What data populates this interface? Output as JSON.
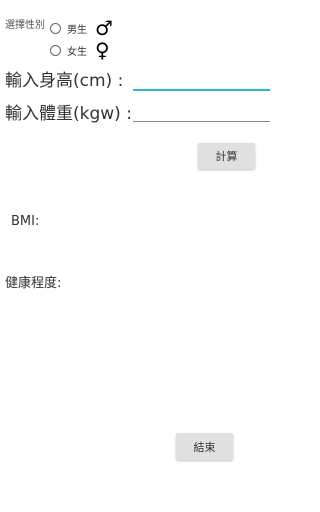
{
  "gender": {
    "label": "選擇性別",
    "options": [
      {
        "label": "男生",
        "icon": "male-symbol-icon",
        "glyph": "♂"
      },
      {
        "label": "女生",
        "icon": "female-symbol-icon",
        "glyph": "♀"
      }
    ]
  },
  "height": {
    "label": "輸入身高(cm) :",
    "value": ""
  },
  "weight": {
    "label": "輸入體重(kgw) :",
    "value": ""
  },
  "buttons": {
    "calculate": "計算",
    "exit": "結束"
  },
  "results": {
    "bmi_label": "BMI:",
    "health_label": "健康程度:"
  },
  "colors": {
    "focus_underline": "#2bb7c5",
    "button_bg": "#e0e0e0"
  }
}
